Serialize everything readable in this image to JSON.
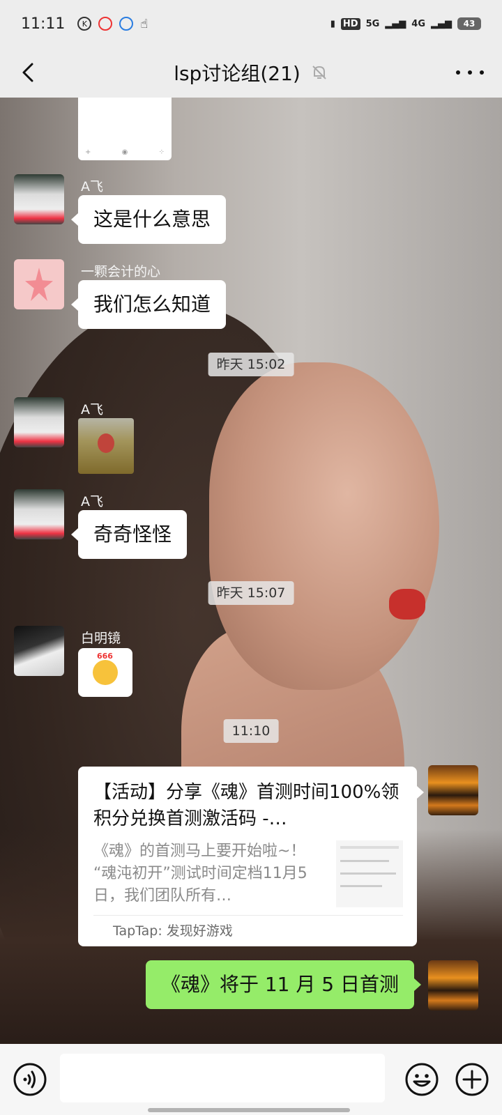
{
  "status_bar": {
    "time": "11:11",
    "network_hd": "HD",
    "network_5g": "5G",
    "network_4g": "4G",
    "battery": "43"
  },
  "header": {
    "title": "lsp讨论组(21)",
    "back_icon": "chevron-left-icon",
    "mute_icon": "bell-off-icon",
    "more_icon": "more-horizontal-icon"
  },
  "messages": [
    {
      "sender": "A飞",
      "text": "这是什么意思"
    },
    {
      "sender": "一颗会计的心",
      "text": "我们怎么知道"
    },
    {
      "time": "昨天 15:02"
    },
    {
      "sender": "A飞",
      "sticker": "sticker-image"
    },
    {
      "sender": "A飞",
      "text": "奇奇怪怪"
    },
    {
      "time": "昨天 15:07"
    },
    {
      "sender": "白明镜",
      "emoji": "666"
    },
    {
      "time": "11:10"
    }
  ],
  "link_card": {
    "title": "【活动】分享《魂》首测时间100%领积分兑换首测激活码 -…",
    "description": "《魂》的首测马上要开始啦~！ “魂沌初开”测试时间定档11月5日，我们团队所有…",
    "source": "TapTap: 发现好游戏"
  },
  "my_message": {
    "text": "《魂》将于 11 月 5 日首测"
  },
  "input_bar": {
    "placeholder": ""
  }
}
